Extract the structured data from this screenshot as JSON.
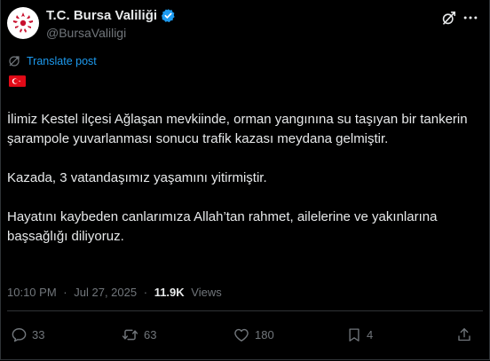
{
  "author": {
    "display_name": "T.C. Bursa Valiliği",
    "handle": "@BursaValiligi",
    "verified": true,
    "avatar_icon": "bursa-governorship-logo"
  },
  "header_icons": [
    "grok-icon",
    "more-icon"
  ],
  "translate": {
    "label": "Translate post",
    "icon": "translate-icon"
  },
  "flag": "turkey-flag",
  "post": {
    "paragraph_1": "İlimiz Kestel ilçesi Ağlaşan mevkiinde, orman yangınına su taşıyan bir tankerin şarampole yuvarlanması sonucu trafik kazası meydana gelmiştir.",
    "paragraph_2": "Kazada, 3 vatandaşımız yaşamını yitirmiştir.",
    "paragraph_3": "Hayatını kaybeden canlarımıza Allah’tan rahmet, ailelerine ve yakınlarına başsağlığı diliyoruz."
  },
  "meta": {
    "time": "10:10 PM",
    "separator": "·",
    "date": "Jul 27, 2025",
    "views_count": "11.9K",
    "views_label": "Views"
  },
  "actions": {
    "replies": "33",
    "reposts": "63",
    "likes": "180",
    "bookmarks": "4"
  },
  "colors": {
    "background": "#000000",
    "text": "#e7e9ea",
    "muted": "#71767b",
    "accent": "#1d9bf0",
    "border": "#2f3336",
    "flag_red": "#e30a17"
  }
}
